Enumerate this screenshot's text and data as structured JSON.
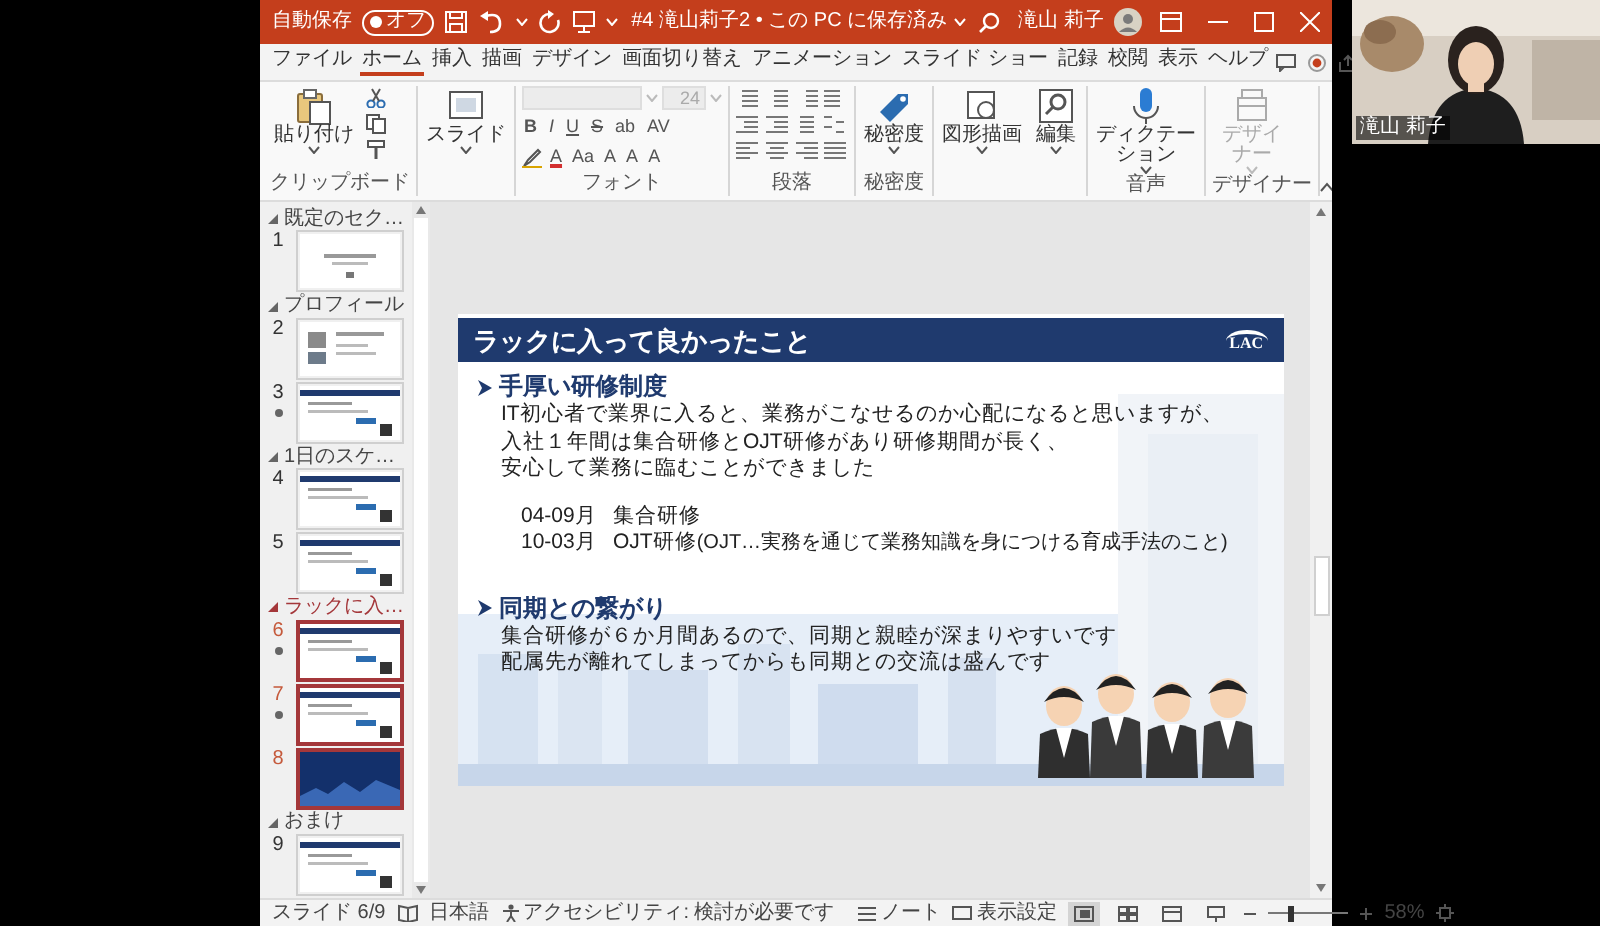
{
  "title_bar": {
    "autosave_label": "自動保存",
    "autosave": {
      "label": "オフ",
      "on": false
    },
    "document_title": "#4 滝山莉子2 • この PC に保存済み",
    "user_name": "滝山 莉子"
  },
  "ribbon_tabs": [
    {
      "label": "ファイル",
      "selected": false
    },
    {
      "label": "ホーム",
      "selected": true
    },
    {
      "label": "挿入",
      "selected": false
    },
    {
      "label": "描画",
      "selected": false
    },
    {
      "label": "デザイン",
      "selected": false
    },
    {
      "label": "画面切り替え",
      "selected": false
    },
    {
      "label": "アニメーション",
      "selected": false
    },
    {
      "label": "スライド ショー",
      "selected": false
    },
    {
      "label": "記録",
      "selected": false
    },
    {
      "label": "校閲",
      "selected": false
    },
    {
      "label": "表示",
      "selected": false
    },
    {
      "label": "ヘルプ",
      "selected": false
    }
  ],
  "ribbon": {
    "clipboard": {
      "paste_label": "貼り付け",
      "group_label": "クリップボード"
    },
    "new_slide_label": "スライド",
    "font": {
      "font_size": "24",
      "style_buttons": [
        "B",
        "I",
        "U",
        "S",
        "ab",
        "AV"
      ],
      "format_buttons": [
        "A",
        "Aa",
        "A",
        "A",
        "A"
      ],
      "group_label": "フォント"
    },
    "paragraph": {
      "group_label": "段落"
    },
    "tool_groups": [
      {
        "group_label": "秘密度",
        "buttons": [
          {
            "kind": "sensitivity",
            "label": "秘密度",
            "disabled": false
          }
        ]
      },
      {
        "buttons": [
          {
            "kind": "shapes",
            "label": "図形描画",
            "disabled": false
          },
          {
            "kind": "find",
            "label": "編集",
            "disabled": false
          }
        ]
      },
      {
        "group_label": "音声",
        "buttons": [
          {
            "kind": "mic",
            "label": "ディクテーション",
            "disabled": false
          }
        ]
      },
      {
        "group_label": "デザイナー",
        "buttons": [
          {
            "kind": "designer",
            "label": "デザイナー",
            "disabled": true
          }
        ]
      }
    ]
  },
  "slide_panel": {
    "sections": [
      {
        "label": "既定のセク…",
        "expanded": true,
        "selected": false,
        "slides": [
          {
            "number": "1",
            "selected": false,
            "starred": false,
            "kind": "title"
          }
        ]
      },
      {
        "label": "プロフィール",
        "expanded": true,
        "selected": false,
        "slides": [
          {
            "number": "2",
            "selected": false,
            "starred": false,
            "kind": "profile"
          },
          {
            "number": "3",
            "selected": false,
            "starred": true,
            "kind": "content"
          }
        ]
      },
      {
        "label": "1日のスケ…",
        "expanded": true,
        "selected": false,
        "slides": [
          {
            "number": "4",
            "selected": false,
            "starred": false,
            "kind": "content"
          },
          {
            "number": "5",
            "selected": false,
            "starred": false,
            "kind": "content"
          }
        ]
      },
      {
        "label": "ラックに入…",
        "expanded": true,
        "selected": true,
        "slides": [
          {
            "number": "6",
            "selected": true,
            "starred": true,
            "kind": "content"
          },
          {
            "number": "7",
            "selected": true,
            "starred": true,
            "kind": "content"
          },
          {
            "number": "8",
            "selected": true,
            "starred": false,
            "kind": "dark"
          }
        ]
      },
      {
        "label": "おまけ",
        "expanded": true,
        "selected": false,
        "slides": [
          {
            "number": "9",
            "selected": false,
            "starred": false,
            "kind": "content"
          }
        ]
      }
    ]
  },
  "slide": {
    "title": "ラックに入って良かったこと",
    "logo": "LAC",
    "sections": [
      {
        "heading": "手厚い研修制度",
        "lines": [
          "IT初心者で業界に入ると、業務がこなせるのか心配になると思いますが、",
          "入社１年間は集合研修とOJT研修があり研修期間が長く、",
          "安心して業務に臨むことができました"
        ],
        "schedule": [
          {
            "period": "04-09月",
            "item": "集合研修"
          },
          {
            "period": "10-03月",
            "item": "OJT研修",
            "note": "(OJT…実務を通じて業務知識を身につける育成手法のこと)"
          }
        ]
      },
      {
        "heading": "同期との繋がり",
        "lines": [
          "集合研修が６か月間あるので、同期と親睦が深まりやすいです",
          "配属先が離れてしまってからも同期との交流は盛んです"
        ]
      }
    ]
  },
  "status_bar": {
    "slide_counter": "スライド 6/9",
    "language": "日本語",
    "accessibility": "アクセシビリティ: 検討が必要です",
    "notes_label": "ノート",
    "display_settings_label": "表示設定",
    "views": [
      {
        "kind": "normal",
        "selected": true
      },
      {
        "kind": "sorter",
        "selected": false
      },
      {
        "kind": "reading",
        "selected": false
      },
      {
        "kind": "slideshow",
        "selected": false
      }
    ],
    "zoom": {
      "level": 0.27,
      "label": "58%"
    }
  },
  "webcam": {
    "name": "滝山 莉子"
  }
}
